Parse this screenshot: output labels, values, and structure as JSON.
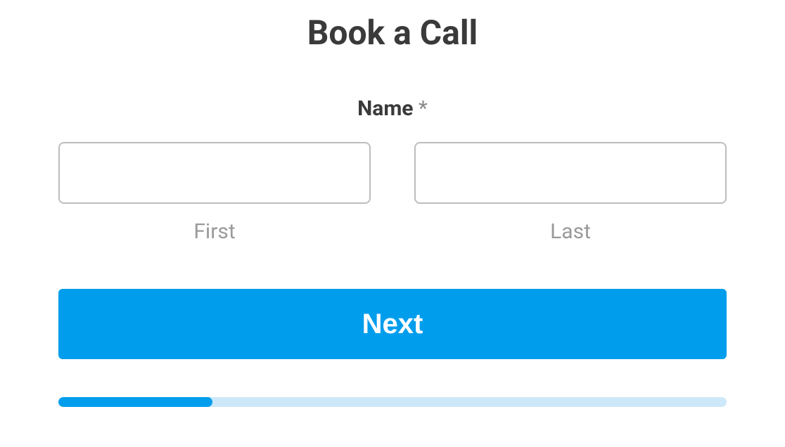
{
  "form": {
    "title": "Book a Call",
    "name_label": "Name",
    "required_marker": "*",
    "first": {
      "value": "",
      "sublabel": "First"
    },
    "last": {
      "value": "",
      "sublabel": "Last"
    },
    "next_button_label": "Next",
    "progress_percent": 23
  }
}
